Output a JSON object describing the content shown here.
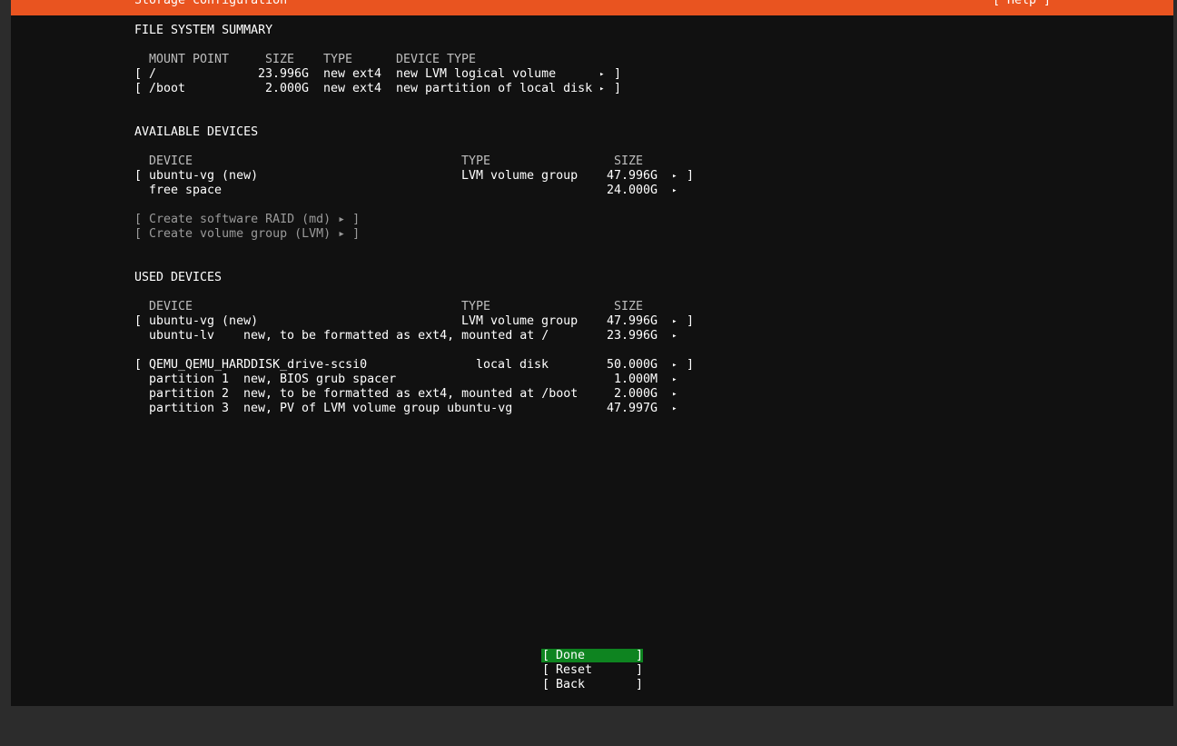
{
  "title": "Storage configuration",
  "help": "[ Help ]",
  "fs_summary": {
    "heading": "FILE SYSTEM SUMMARY",
    "columns": {
      "mount": "MOUNT POINT",
      "size": "SIZE",
      "type": "TYPE",
      "device_type": "DEVICE TYPE"
    },
    "rows": [
      {
        "mount": "/",
        "size": "23.996G",
        "type": "new ext4",
        "device_type": "new LVM logical volume"
      },
      {
        "mount": "/boot",
        "size": "2.000G",
        "type": "new ext4",
        "device_type": "new partition of local disk"
      }
    ]
  },
  "available": {
    "heading": "AVAILABLE DEVICES",
    "columns": {
      "device": "DEVICE",
      "type": "TYPE",
      "size": "SIZE"
    },
    "group": {
      "device": "ubuntu-vg (new)",
      "type": "LVM volume group",
      "size": "47.996G"
    },
    "free": {
      "device": "free space",
      "size": "24.000G"
    },
    "actions": [
      "[ Create software RAID (md) ▸ ]",
      "[ Create volume group (LVM) ▸ ]"
    ]
  },
  "used": {
    "heading": "USED DEVICES",
    "columns": {
      "device": "DEVICE",
      "type": "TYPE",
      "size": "SIZE"
    },
    "vg": {
      "device": "ubuntu-vg (new)",
      "type": "LVM volume group",
      "size": "47.996G"
    },
    "lv": {
      "name": "ubuntu-lv",
      "desc": "new, to be formatted as ext4, mounted at /",
      "size": "23.996G"
    },
    "disk": {
      "device": "QEMU_QEMU_HARDDISK_drive-scsi0",
      "type": "local disk",
      "size": "50.000G"
    },
    "partitions": [
      {
        "name": "partition 1",
        "desc": "new, BIOS grub spacer",
        "size": "1.000M"
      },
      {
        "name": "partition 2",
        "desc": "new, to be formatted as ext4, mounted at /boot",
        "size": "2.000G"
      },
      {
        "name": "partition 3",
        "desc": "new, PV of LVM volume group ubuntu-vg",
        "size": "47.997G"
      }
    ]
  },
  "buttons": {
    "done": "Done",
    "reset": "Reset",
    "back": "Back"
  },
  "glyphs": {
    "open": "[",
    "close": "]",
    "arrow": "▸"
  },
  "colors": {
    "titlebar": "#e95420",
    "selected_button": "#0e8420",
    "background": "#111111"
  }
}
